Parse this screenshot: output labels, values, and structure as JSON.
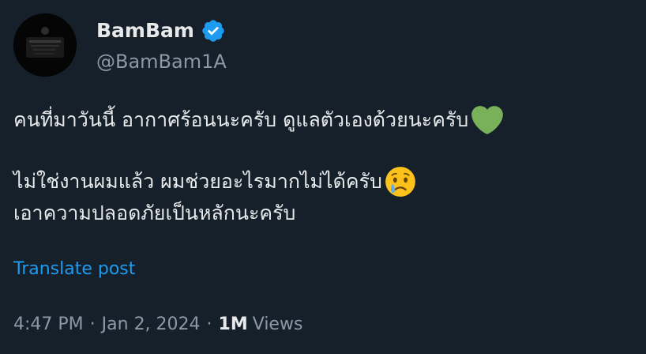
{
  "user": {
    "display_name": "BamBam",
    "handle": "@BamBam1A",
    "verified": true
  },
  "tweet": {
    "line1": "คนที่มาวันนี้ อากาศร้อนนะครับ ดูแลตัวเองด้วยนะครับ",
    "line1_emoji": "green-heart",
    "line2": "ไม่ใช่งานผมแล้ว ผมช่วยอะไรมากไม่ได้ครับ",
    "line2_emoji": "crying-face",
    "line3": "เอาความปลอดภัยเป็นหลักนะครับ"
  },
  "translate_label": "Translate post",
  "meta": {
    "time": "4:47 PM",
    "separator": "·",
    "date": "Jan 2, 2024",
    "views_count": "1M",
    "views_label": "Views"
  },
  "colors": {
    "background": "#15202b",
    "text": "#e7e9ea",
    "muted": "#8b98a5",
    "accent": "#1d9bf0",
    "heart": "#78b159",
    "crying_face": "#fcc21b"
  }
}
